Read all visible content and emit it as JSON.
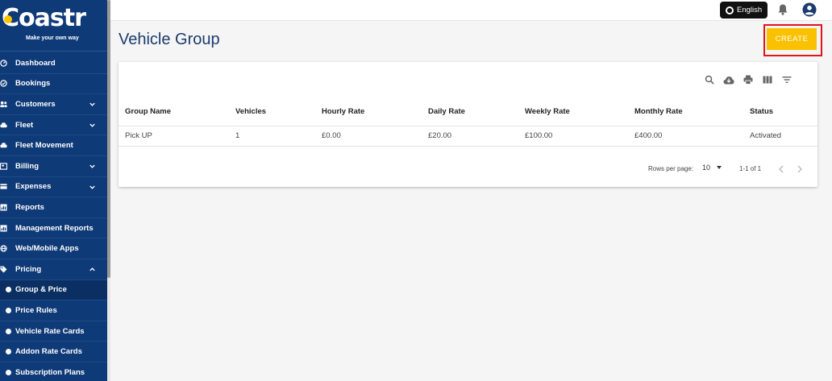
{
  "brand": {
    "name": "oastr",
    "tagline": "Make your own way"
  },
  "sidebar": {
    "items": [
      {
        "label": "Dashboard",
        "icon": "dashboard-icon"
      },
      {
        "label": "Bookings",
        "icon": "check-circle-icon"
      },
      {
        "label": "Customers",
        "icon": "users-icon",
        "expand": "down"
      },
      {
        "label": "Fleet",
        "icon": "car-icon",
        "expand": "down"
      },
      {
        "label": "Fleet Movement",
        "icon": "route-icon"
      },
      {
        "label": "Billing",
        "icon": "billing-icon",
        "expand": "down"
      },
      {
        "label": "Expenses",
        "icon": "expenses-icon",
        "expand": "down"
      },
      {
        "label": "Reports",
        "icon": "reports-icon"
      },
      {
        "label": "Management Reports",
        "icon": "reports-icon"
      },
      {
        "label": "Web/Mobile Apps",
        "icon": "globe-icon"
      },
      {
        "label": "Pricing",
        "icon": "tag-icon",
        "expand": "up"
      }
    ],
    "subitems": [
      {
        "label": "Group & Price",
        "active": true
      },
      {
        "label": "Price Rules"
      },
      {
        "label": "Vehicle Rate Cards"
      },
      {
        "label": "Addon Rate Cards"
      },
      {
        "label": "Subscription Plans"
      }
    ]
  },
  "topbar": {
    "language": "English"
  },
  "page": {
    "title": "Vehicle Group",
    "create_label": "CREATE"
  },
  "table": {
    "columns": [
      "Group Name",
      "Vehicles",
      "Hourly Rate",
      "Daily Rate",
      "Weekly Rate",
      "Monthly Rate",
      "Status"
    ],
    "rows": [
      [
        "Pick UP",
        "1",
        "£0.00",
        "£20.00",
        "£100.00",
        "£400.00",
        "Activated"
      ]
    ],
    "rows_per_page_label": "Rows per page:",
    "rows_per_page": "10",
    "range": "1-1 of 1"
  },
  "colors": {
    "sidebar": "#0f3a78",
    "accent": "#f9c100",
    "highlight": "#e0161b",
    "title": "#1a3c6e"
  }
}
